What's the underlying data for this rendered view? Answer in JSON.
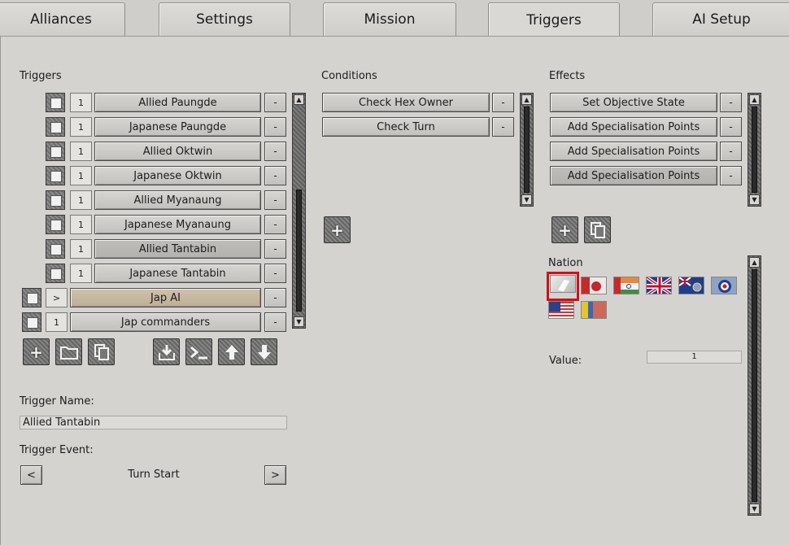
{
  "tabs": [
    "Alliances",
    "Settings",
    "Mission",
    "Triggers",
    "AI Setup"
  ],
  "triggers": {
    "heading": "Triggers",
    "items": [
      {
        "count": "1",
        "label": "Allied Paungde"
      },
      {
        "count": "1",
        "label": "Japanese Paungde"
      },
      {
        "count": "1",
        "label": "Allied Oktwin"
      },
      {
        "count": "1",
        "label": "Japanese Oktwin"
      },
      {
        "count": "1",
        "label": "Allied Myanaung"
      },
      {
        "count": "1",
        "label": "Japanese Myanaung"
      },
      {
        "count": "1",
        "label": "Allied Tantabin"
      },
      {
        "count": "1",
        "label": "Japanese Tantabin"
      },
      {
        "count": ">",
        "label": "Jap AI"
      },
      {
        "count": "1",
        "label": "Jap commanders"
      }
    ],
    "remove_label": "-"
  },
  "conditions": {
    "heading": "Conditions",
    "items": [
      "Check Hex Owner",
      "Check Turn"
    ]
  },
  "effects": {
    "heading": "Effects",
    "items": [
      "Set Objective State",
      "Add Specialisation Points",
      "Add Specialisation Points",
      "Add Specialisation Points"
    ]
  },
  "nation": {
    "heading": "Nation",
    "flags": [
      "neutral-flag",
      "japan-flag",
      "india-flag",
      "uk-flag",
      "australia-flag",
      "raf-roundel-flag",
      "usa-flag",
      "mixed-flag"
    ]
  },
  "value": {
    "label": "Value:",
    "amount": "1"
  },
  "trigger_name": {
    "label": "Trigger Name:",
    "value": "Allied Tantabin"
  },
  "trigger_event": {
    "label": "Trigger Event:",
    "value": "Turn Start",
    "prev": "<",
    "next": ">"
  },
  "icons": {
    "add": "+",
    "folder": "folder-icon",
    "copy": "copy-icon",
    "import": "import-icon",
    "console": "console-icon",
    "up": "arrow-up-icon",
    "down": "arrow-down-icon"
  }
}
